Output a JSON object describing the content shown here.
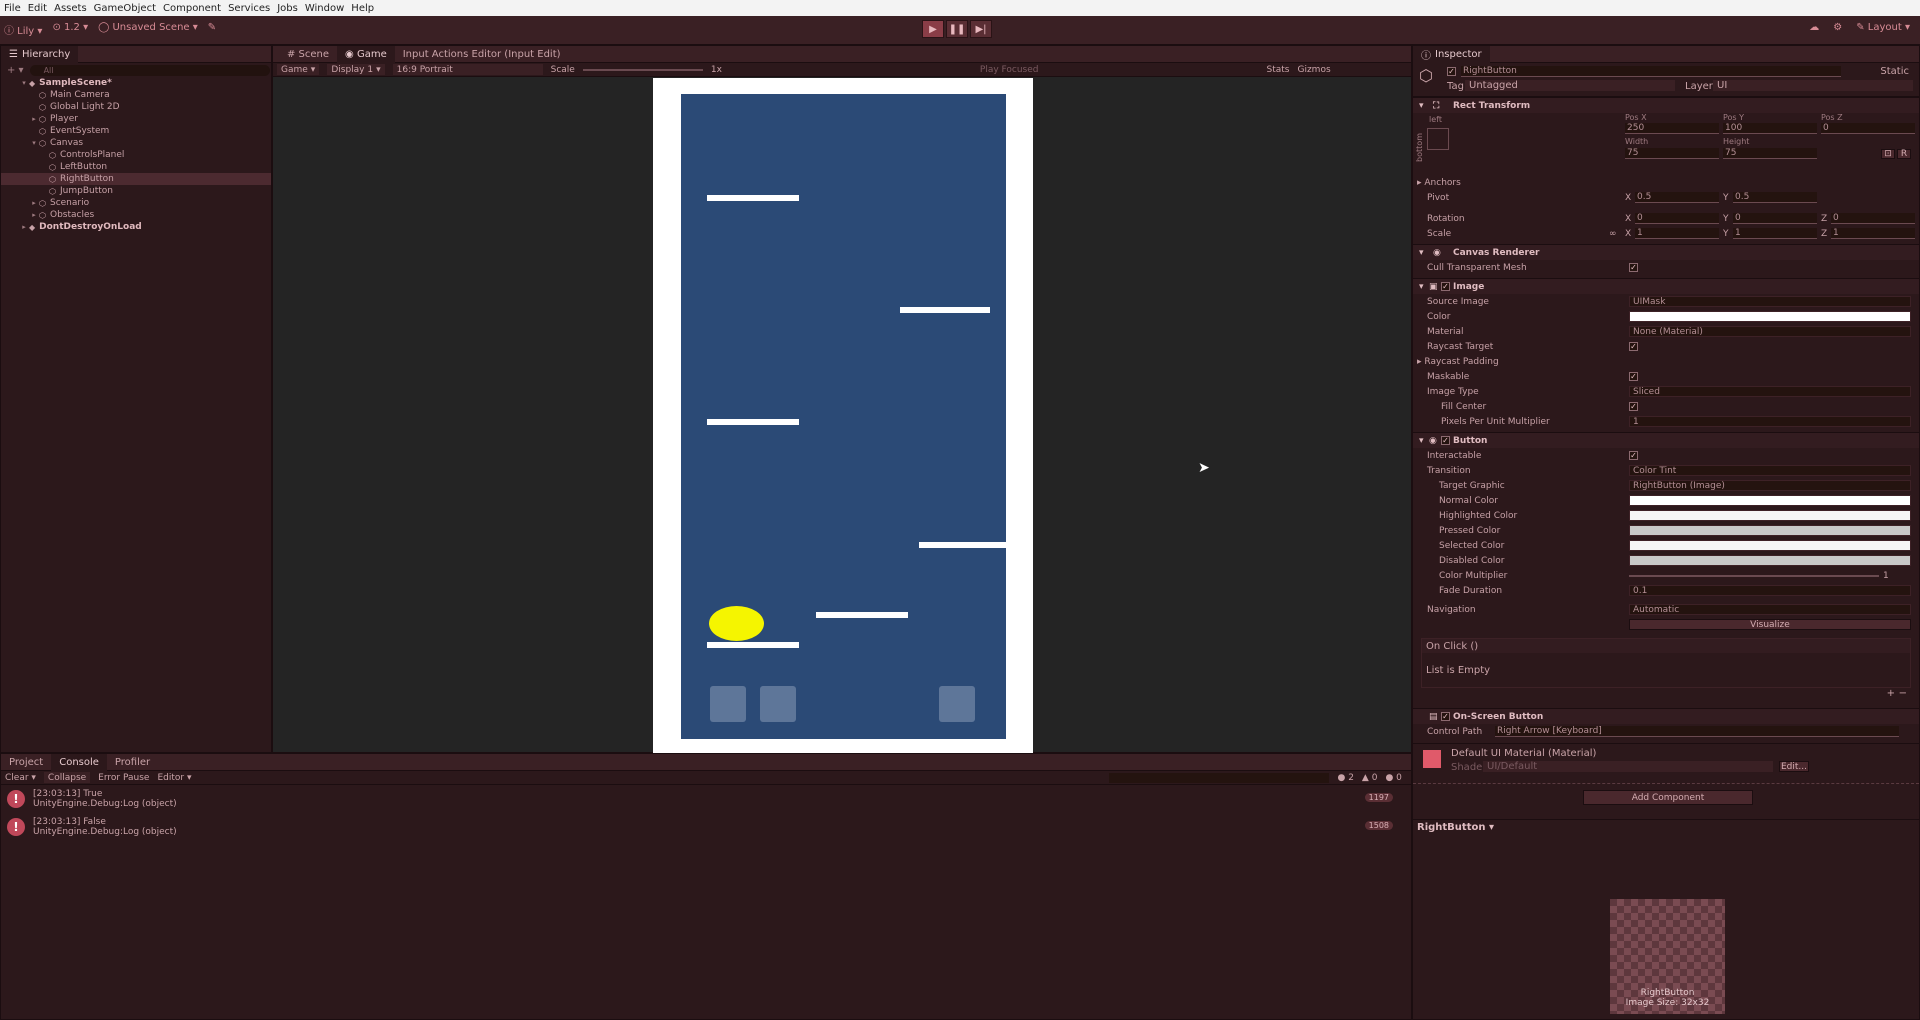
{
  "menu": [
    "File",
    "Edit",
    "Assets",
    "GameObject",
    "Component",
    "Services",
    "Jobs",
    "Window",
    "Help"
  ],
  "toolbar": {
    "left_items": [
      "ⓘ Lily ▾",
      "⊙ 1.2 ▾",
      "◯ Unsaved Scene ▾",
      "✎"
    ],
    "play": "▶",
    "pause": "❚❚",
    "step": "▶|",
    "right_items": [
      "☁",
      "⚙",
      "✎ Layout ▾"
    ]
  },
  "hierarchy": {
    "tab": "Hierarchy",
    "add": "+ ▾",
    "search_placeholder": "All",
    "items": [
      {
        "label": "SampleScene*",
        "depth": 0,
        "arrow": "▾",
        "scene": true
      },
      {
        "label": "Main Camera",
        "depth": 1,
        "arrow": ""
      },
      {
        "label": "Global Light 2D",
        "depth": 1,
        "arrow": ""
      },
      {
        "label": "Player",
        "depth": 1,
        "arrow": "▸"
      },
      {
        "label": "EventSystem",
        "depth": 1,
        "arrow": ""
      },
      {
        "label": "Canvas",
        "depth": 1,
        "arrow": "▾"
      },
      {
        "label": "ControlsPlanel",
        "depth": 2,
        "arrow": ""
      },
      {
        "label": "LeftButton",
        "depth": 2,
        "arrow": ""
      },
      {
        "label": "RightButton",
        "depth": 2,
        "arrow": "",
        "selected": true
      },
      {
        "label": "JumpButton",
        "depth": 2,
        "arrow": ""
      },
      {
        "label": "Scenario",
        "depth": 1,
        "arrow": "▸"
      },
      {
        "label": "Obstacles",
        "depth": 1,
        "arrow": "▸"
      },
      {
        "label": "DontDestroyOnLoad",
        "depth": 0,
        "arrow": "▸",
        "scene": true
      }
    ]
  },
  "center_tabs": [
    "# Scene",
    "◉ Game",
    "Input Actions Editor (Input Edit)"
  ],
  "game_toolbar": {
    "mode": "Game",
    "display": "Display 1",
    "aspect": "16:9 Portrait",
    "scale_label": "Scale",
    "scale_value": "1x",
    "play_focused": "Play Focused",
    "stats": "Stats",
    "gizmos": "Gizmos"
  },
  "console": {
    "tabs": [
      "Project",
      "Console",
      "Profiler"
    ],
    "clear": "Clear ▾",
    "collapse": "Collapse",
    "error_pause": "Error Pause",
    "editor": "Editor ▾",
    "counts": [
      "2",
      "0",
      "0"
    ],
    "logs": [
      {
        "line1": "[23:03:13] True",
        "line2": "UnityEngine.Debug:Log (object)",
        "count": "1197"
      },
      {
        "line1": "[23:03:13] False",
        "line2": "UnityEngine.Debug:Log (object)",
        "count": "1508"
      }
    ]
  },
  "inspector": {
    "tab": "Inspector",
    "object_name": "RightButton",
    "static": "Static",
    "tag_label": "Tag",
    "tag": "Untagged",
    "layer_label": "Layer",
    "layer": "UI",
    "rect_transform": {
      "title": "Rect Transform",
      "anchor_preset_left": "left",
      "anchor_preset_bottom": "bottom",
      "pos_x_label": "Pos X",
      "pos_y_label": "Pos Y",
      "pos_z_label": "Pos Z",
      "pos_x": "250",
      "pos_y": "100",
      "pos_z": "0",
      "width_label": "Width",
      "height_label": "Height",
      "width": "75",
      "height": "75",
      "anchors": "Anchors",
      "pivot": "Pivot",
      "pivot_x": "0.5",
      "pivot_y": "0.5",
      "rotation": "Rotation",
      "rot_x": "0",
      "rot_y": "0",
      "rot_z": "0",
      "scale": "Scale",
      "scale_x": "1",
      "scale_y": "1",
      "scale_z": "1",
      "x": "X",
      "y": "Y",
      "z": "Z"
    },
    "canvas_renderer": {
      "title": "Canvas Renderer",
      "cull": "Cull Transparent Mesh"
    },
    "image": {
      "title": "Image",
      "source_image_label": "Source Image",
      "source_image": "UIMask",
      "color_label": "Color",
      "material_label": "Material",
      "material": "None (Material)",
      "raycast_target": "Raycast Target",
      "raycast_padding": "Raycast Padding",
      "maskable": "Maskable",
      "image_type_label": "Image Type",
      "image_type": "Sliced",
      "fill_center": "Fill Center",
      "ppu_label": "Pixels Per Unit Multiplier",
      "ppu": "1"
    },
    "button": {
      "title": "Button",
      "interactable": "Interactable",
      "transition_label": "Transition",
      "transition": "Color Tint",
      "target_graphic_label": "Target Graphic",
      "target_graphic": "RightButton (Image)",
      "normal": "Normal Color",
      "highlighted": "Highlighted Color",
      "pressed": "Pressed Color",
      "selected": "Selected Color",
      "disabled": "Disabled Color",
      "multiplier_label": "Color Multiplier",
      "multiplier": "1",
      "fade_label": "Fade Duration",
      "fade": "0.1",
      "navigation_label": "Navigation",
      "navigation": "Automatic",
      "visualize": "Visualize",
      "onclick": "On Click ()",
      "list_empty": "List is Empty"
    },
    "onscreen": {
      "title": "On-Screen Button",
      "control_path_label": "Control Path",
      "control_path": "Right Arrow [Keyboard]"
    },
    "material": {
      "title": "Default UI Material (Material)",
      "shader_label": "Shader",
      "shader": "UI/Default",
      "edit": "Edit..."
    },
    "add_component": "Add Component",
    "preview_title": "RightButton ▾",
    "preview_name": "RightButton",
    "preview_size": "Image Size: 32x32"
  },
  "colors": {
    "game_bg": "#2b4a76",
    "ball": "#f5f500",
    "accent": "#c0485a"
  }
}
